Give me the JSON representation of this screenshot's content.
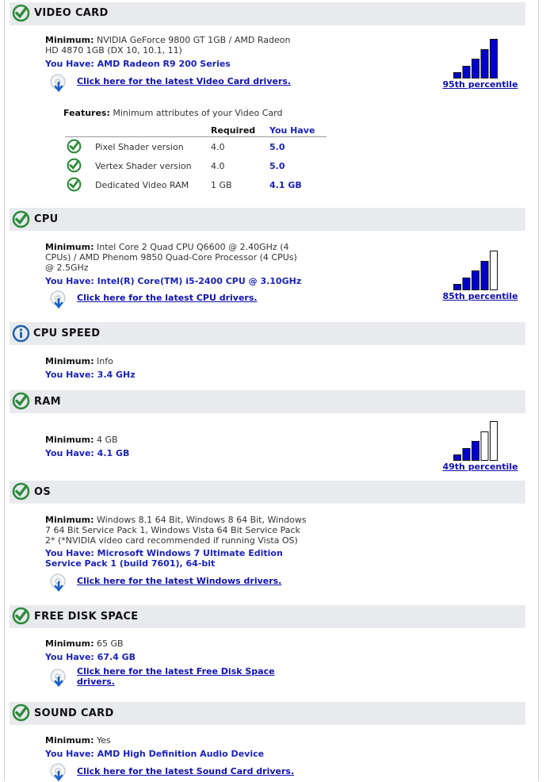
{
  "sections": {
    "video": {
      "title": "VIDEO CARD",
      "min_label": "Minimum:",
      "min_line1": "NVIDIA GeForce 9800 GT 1GB / AMD Radeon",
      "min_line2": "HD 4870 1GB (DX 10, 10.1, 11)",
      "have": "You Have: AMD Radeon R9 200 Series",
      "driver_link": "Click here for the latest Video Card drivers.",
      "percentile": "95th percentile",
      "filled_bars": 5,
      "features": {
        "label": "Features:",
        "text": "Minimum attributes of your Video Card",
        "col_required": "Required",
        "col_have": "You Have",
        "rows": [
          {
            "name": "Pixel Shader version",
            "required": "4.0",
            "have": "5.0"
          },
          {
            "name": "Vertex Shader version",
            "required": "4.0",
            "have": "5.0"
          },
          {
            "name": "Dedicated Video RAM",
            "required": "1 GB",
            "have": "4.1 GB"
          }
        ]
      }
    },
    "cpu": {
      "title": "CPU",
      "min_label": "Minimum:",
      "min_line1": "Intel Core 2 Quad CPU Q6600 @ 2.40GHz (4",
      "min_line2": "CPUs) / AMD Phenom 9850 Quad-Core Processor (4 CPUs)",
      "min_line3": "@ 2.5GHz",
      "have": "You Have: Intel(R) Core(TM) i5-2400 CPU @ 3.10GHz",
      "driver_link": "Click here for the latest CPU drivers.",
      "percentile": "85th percentile",
      "filled_bars": 4
    },
    "cpu_speed": {
      "title": "CPU SPEED",
      "min_label": "Minimum:",
      "min_value": "Info",
      "have": "You Have: 3.4 GHz"
    },
    "ram": {
      "title": "RAM",
      "min_label": "Minimum:",
      "min_value": "4 GB",
      "have": "You Have: 4.1 GB",
      "percentile": "49th percentile",
      "filled_bars": 3
    },
    "os": {
      "title": "OS",
      "min_label": "Minimum:",
      "min_line1": "Windows 8.1 64 Bit, Windows 8 64 Bit, Windows",
      "min_line2": "7 64 Bit Service Pack 1, Windows Vista 64 Bit Service Pack",
      "min_line3": "2* (*NVIDIA video card recommended if running Vista OS)",
      "have_line1": "You Have: Microsoft Windows 7 Ultimate Edition",
      "have_line2": "Service Pack 1 (build 7601), 64-bit",
      "driver_link": "Click here for the latest Windows drivers."
    },
    "disk": {
      "title": "FREE DISK SPACE",
      "min_label": "Minimum:",
      "min_value": "65 GB",
      "have": "You Have: 67.4 GB",
      "driver_link_line1": "Click here for the latest Free Disk Space",
      "driver_link_line2": "drivers."
    },
    "sound": {
      "title": "SOUND CARD",
      "min_label": "Minimum:",
      "min_value": "Yes",
      "have": "You Have: AMD High Definition Audio Device",
      "driver_link": "Click here for the latest Sound Card drivers."
    }
  },
  "colors": {
    "pass_green": "#2e8b3a",
    "info_blue": "#1f5fa8",
    "link_blue": "#1010b0",
    "meter_fill": "#0000cc"
  }
}
